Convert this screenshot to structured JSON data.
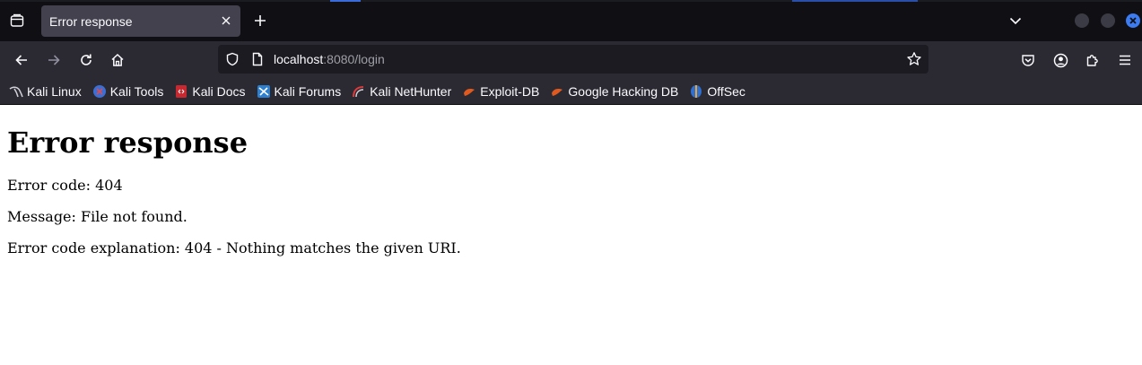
{
  "browser": {
    "tab": {
      "title": "Error response"
    },
    "url": {
      "host": "localhost",
      "rest": ":8080/login"
    },
    "bookmarks": [
      {
        "label": "Kali Linux",
        "icon": "kali-dragon-icon"
      },
      {
        "label": "Kali Tools",
        "icon": "kali-tools-icon"
      },
      {
        "label": "Kali Docs",
        "icon": "kali-docs-icon"
      },
      {
        "label": "Kali Forums",
        "icon": "kali-forums-icon"
      },
      {
        "label": "Kali NetHunter",
        "icon": "kali-nethunter-icon"
      },
      {
        "label": "Exploit-DB",
        "icon": "exploit-db-icon"
      },
      {
        "label": "Google Hacking DB",
        "icon": "ghdb-icon"
      },
      {
        "label": "OffSec",
        "icon": "offsec-icon"
      }
    ],
    "colors": {
      "chrome_dark": "#0f0f14",
      "toolbar": "#2b2a33",
      "urlbar": "#1c1b22",
      "close_accent": "#3d7bf0"
    }
  },
  "page": {
    "heading": "Error response",
    "lines": [
      "Error code: 404",
      "Message: File not found.",
      "Error code explanation: 404 - Nothing matches the given URI."
    ]
  }
}
